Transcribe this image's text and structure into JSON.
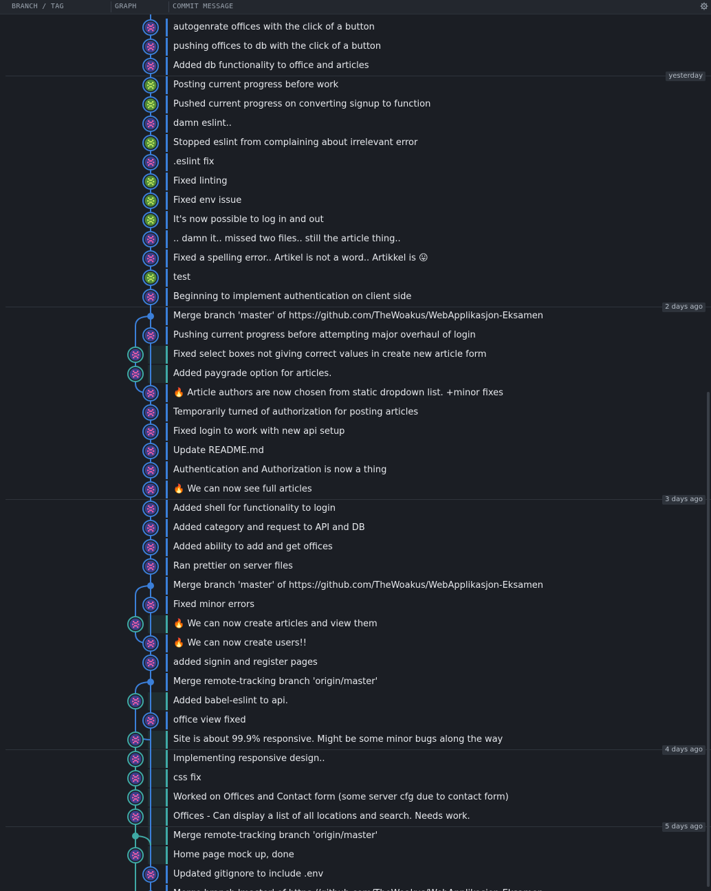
{
  "header": {
    "branch_tag": "BRANCH / TAG",
    "graph": "GRAPH",
    "commit_message": "COMMIT MESSAGE",
    "settings_icon": "gear-icon"
  },
  "colors": {
    "lane_blue": "#3b7fd9",
    "lane_teal": "#3fa9a5",
    "background": "#1b1e24"
  },
  "commits": [
    {
      "message": "autogenrate offices with the click of a button",
      "lane": 1,
      "avatar": "pink"
    },
    {
      "message": "pushing offices to db with the click of a button",
      "lane": 1,
      "avatar": "pink"
    },
    {
      "message": "Added db functionality to office and articles",
      "lane": 1,
      "avatar": "pink"
    },
    {
      "message": "Posting current progress before work",
      "lane": 1,
      "avatar": "green"
    },
    {
      "message": "Pushed current progress on converting signup to function",
      "lane": 1,
      "avatar": "green"
    },
    {
      "message": "damn eslint..",
      "lane": 1,
      "avatar": "pink"
    },
    {
      "message": "Stopped eslint from complaining about irrelevant error",
      "lane": 1,
      "avatar": "green"
    },
    {
      "message": ".eslint fix",
      "lane": 1,
      "avatar": "pink"
    },
    {
      "message": "Fixed linting",
      "lane": 1,
      "avatar": "green"
    },
    {
      "message": "Fixed env issue",
      "lane": 1,
      "avatar": "green"
    },
    {
      "message": "It's now possible to log in and out",
      "lane": 1,
      "avatar": "green"
    },
    {
      "message": ".. damn it.. missed two files.. still the article thing..",
      "lane": 1,
      "avatar": "pink"
    },
    {
      "message": "Fixed a spelling error.. Artikel is not a word.. Artikkel is 😛",
      "lane": 1,
      "avatar": "pink"
    },
    {
      "message": "test",
      "lane": 1,
      "avatar": "green"
    },
    {
      "message": "Beginning to implement authentication on client side",
      "lane": 1,
      "avatar": "pink"
    },
    {
      "message": "Merge branch 'master' of https://github.com/TheWoakus/WebApplikasjon-Eksamen",
      "lane": 1,
      "avatar": "merge"
    },
    {
      "message": "Pushing current progress before attempting major overhaul of login",
      "lane": 1,
      "avatar": "pink"
    },
    {
      "message": "Fixed select boxes not giving correct values in create new article form",
      "lane": 0,
      "avatar": "pink"
    },
    {
      "message": "Added paygrade option for articles.",
      "lane": 0,
      "avatar": "pink"
    },
    {
      "message": "🔥 Article authors are now chosen from static dropdown list. +minor fixes",
      "lane": 1,
      "avatar": "pink"
    },
    {
      "message": "Temporarily turned of authorization for posting articles",
      "lane": 1,
      "avatar": "pink"
    },
    {
      "message": "Fixed login to work with new api setup",
      "lane": 1,
      "avatar": "pink"
    },
    {
      "message": "Update README.md",
      "lane": 1,
      "avatar": "pink"
    },
    {
      "message": "Authentication and Authorization is now a thing",
      "lane": 1,
      "avatar": "pink"
    },
    {
      "message": "🔥 We can now see full articles",
      "lane": 1,
      "avatar": "pink"
    },
    {
      "message": "Added shell for functionality to login",
      "lane": 1,
      "avatar": "pink"
    },
    {
      "message": "Added category and request to API and DB",
      "lane": 1,
      "avatar": "pink"
    },
    {
      "message": "Added ability to add and get offices",
      "lane": 1,
      "avatar": "pink"
    },
    {
      "message": "Ran prettier on server files",
      "lane": 1,
      "avatar": "pink"
    },
    {
      "message": "Merge branch 'master' of https://github.com/TheWoakus/WebApplikasjon-Eksamen",
      "lane": 1,
      "avatar": "merge"
    },
    {
      "message": "Fixed minor errors",
      "lane": 1,
      "avatar": "pink"
    },
    {
      "message": "🔥 We can now create articles and view them",
      "lane": 0,
      "avatar": "pink"
    },
    {
      "message": "🔥 We can now create users!!",
      "lane": 1,
      "avatar": "pink"
    },
    {
      "message": "added signin and register pages",
      "lane": 1,
      "avatar": "pink"
    },
    {
      "message": "Merge remote-tracking branch 'origin/master'",
      "lane": 1,
      "avatar": "merge"
    },
    {
      "message": "Added babel-eslint to api.",
      "lane": 0,
      "avatar": "pink"
    },
    {
      "message": "office view fixed",
      "lane": 1,
      "avatar": "pink"
    },
    {
      "message": "Site is about 99.9% responsive. Might be some minor bugs along the way",
      "lane": 0,
      "avatar": "pink"
    },
    {
      "message": "Implementing responsive design..",
      "lane": 0,
      "avatar": "pink"
    },
    {
      "message": "css fix",
      "lane": 0,
      "avatar": "pink"
    },
    {
      "message": "Worked on Offices and Contact form (some server cfg due to contact form)",
      "lane": 0,
      "avatar": "pink"
    },
    {
      "message": "Offices - Can display a list of all locations and search. Needs work.",
      "lane": 0,
      "avatar": "pink"
    },
    {
      "message": "Merge remote-tracking branch 'origin/master'",
      "lane": 0,
      "avatar": "merge"
    },
    {
      "message": "Home page mock up, done",
      "lane": 0,
      "avatar": "pink"
    },
    {
      "message": "Updated gitignore to include .env",
      "lane": 1,
      "avatar": "pink"
    },
    {
      "message": "Merge branch 'master' of https://github.com/TheWoakus/WebApplikasjon-Eksamen",
      "lane": 1,
      "avatar": "merge"
    }
  ],
  "date_markers": [
    {
      "after_index": 2,
      "label": "yesterday"
    },
    {
      "after_index": 14,
      "label": "2 days ago"
    },
    {
      "after_index": 24,
      "label": "3 days ago"
    },
    {
      "after_index": 37,
      "label": "4 days ago"
    },
    {
      "after_index": 41,
      "label": "5 days ago"
    }
  ]
}
